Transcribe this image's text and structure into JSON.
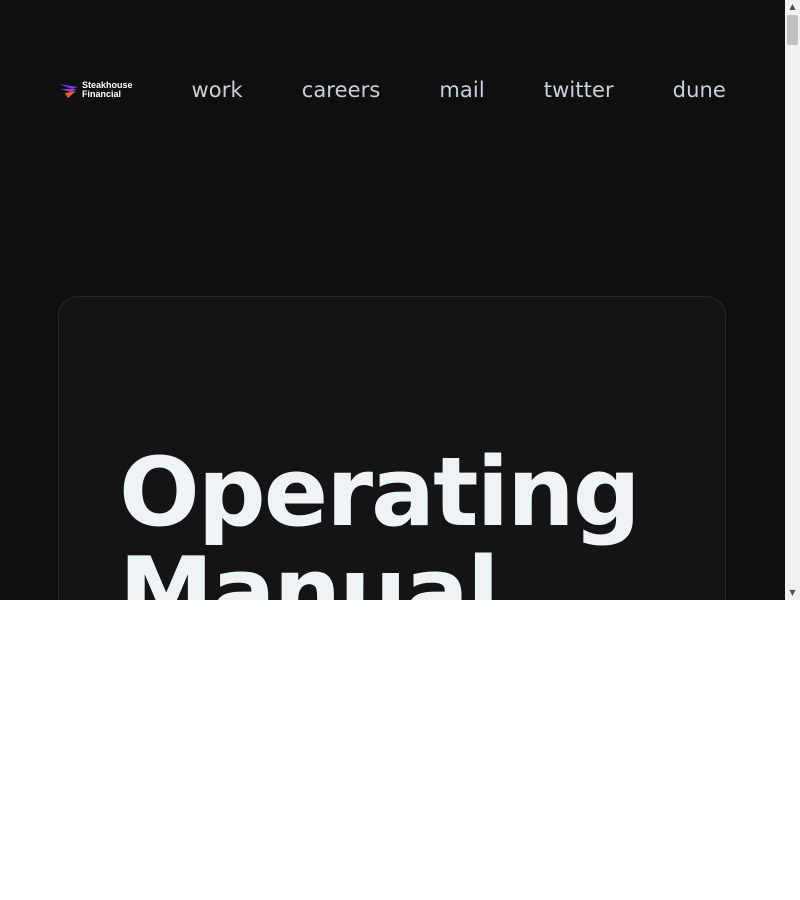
{
  "header": {
    "logo": {
      "line1": "Steakhouse",
      "line2": "Financial",
      "colors": [
        "#6b3fd6",
        "#9a3ee0",
        "#f2602c"
      ]
    },
    "nav": [
      {
        "label": "work"
      },
      {
        "label": "careers"
      },
      {
        "label": "mail"
      },
      {
        "label": "twitter"
      },
      {
        "label": "dune"
      }
    ]
  },
  "hero": {
    "title_line1": "Operating",
    "title_line2": "Manual"
  },
  "scrollbar": {
    "up_icon": "triangle-up",
    "down_icon": "triangle-down"
  }
}
